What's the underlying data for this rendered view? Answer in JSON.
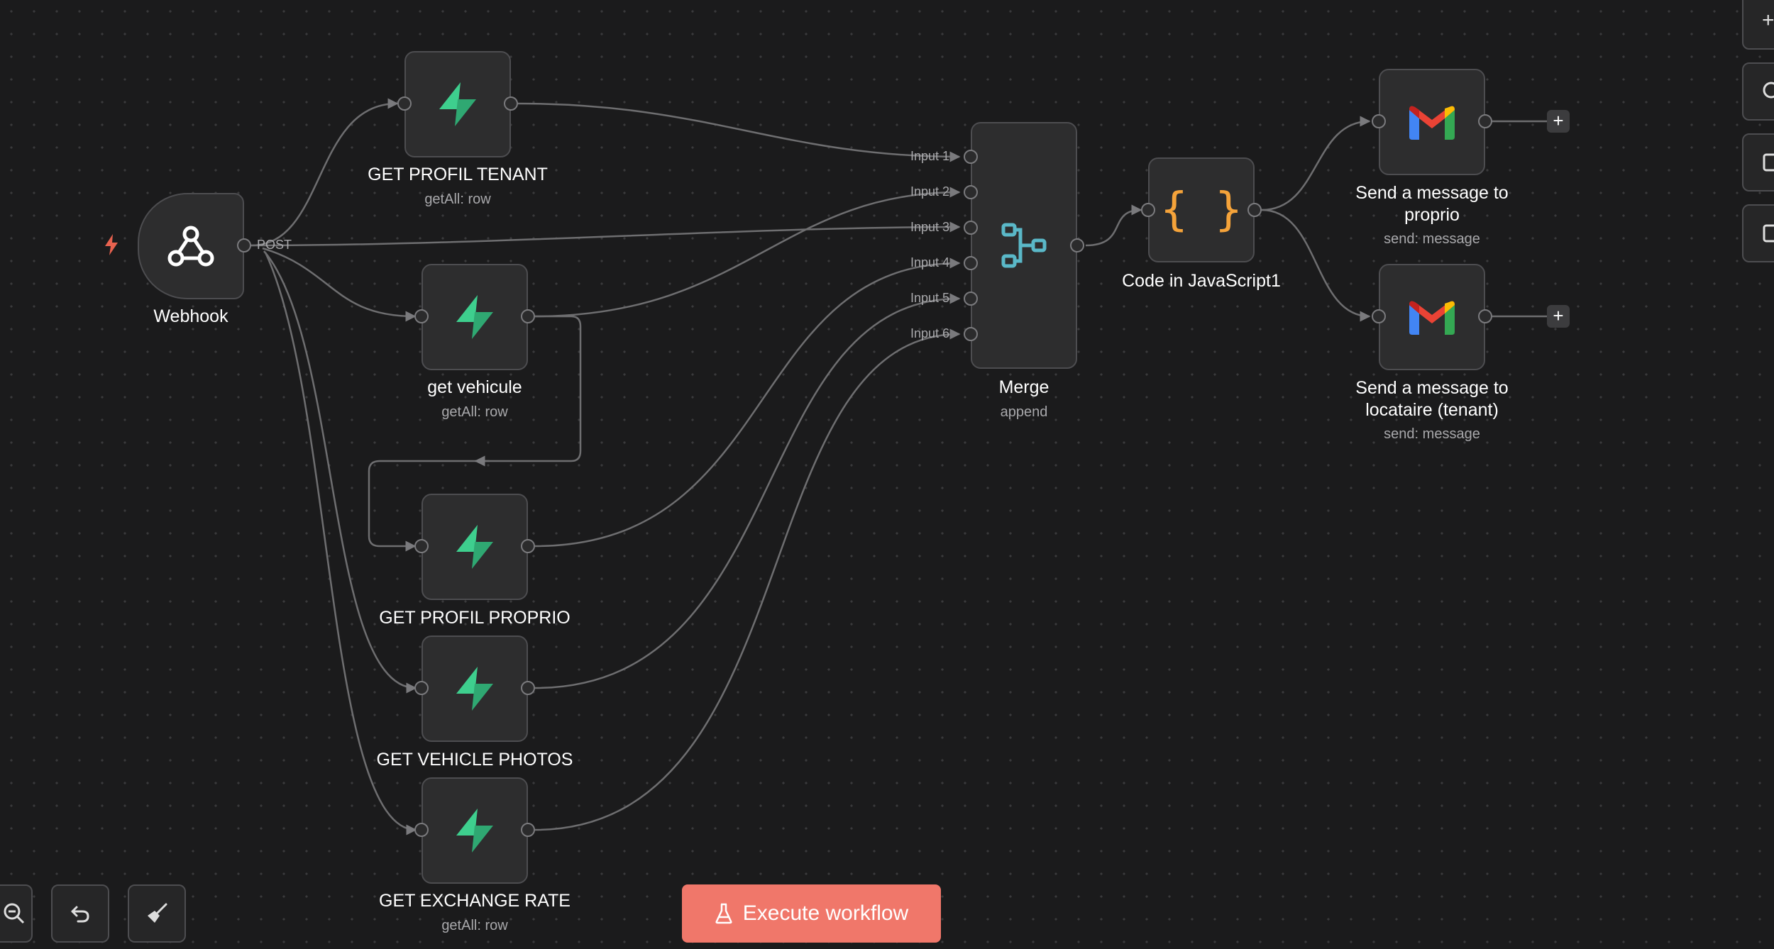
{
  "colors": {
    "canvas": "#1b1b1c",
    "node_bg": "#2d2d2e",
    "edge": "#6e6e70",
    "supabase_green": "#3ecf8e",
    "merge_blue": "#5ab8c8",
    "code_orange": "#f5a33a",
    "execute_button": "#f0776a",
    "trigger_bolt": "#e8624f"
  },
  "nodes": {
    "webhook": {
      "title": "Webhook",
      "output_label": "POST",
      "icon": "webhook-icon"
    },
    "get_profil_tenant": {
      "title": "GET PROFIL TENANT",
      "subtitle": "getAll: row",
      "icon": "supabase-icon"
    },
    "get_vehicule": {
      "title": "get vehicule",
      "subtitle": "getAll: row",
      "icon": "supabase-icon"
    },
    "get_profil_proprio": {
      "title": "GET PROFIL PROPRIO",
      "icon": "supabase-icon"
    },
    "get_vehicle_photos": {
      "title": "GET VEHICLE PHOTOS",
      "icon": "supabase-icon"
    },
    "get_exchange_rate": {
      "title": "GET EXCHANGE RATE",
      "subtitle": "getAll: row",
      "icon": "supabase-icon"
    },
    "merge": {
      "title": "Merge",
      "subtitle": "append",
      "icon": "merge-icon",
      "inputs": [
        "Input 1",
        "Input 2",
        "Input 3",
        "Input 4",
        "Input 5",
        "Input 6"
      ]
    },
    "code": {
      "title": "Code in JavaScript1",
      "icon": "code-braces-icon",
      "glyph": "{ }"
    },
    "send_proprio": {
      "title_line1": "Send a message to",
      "title_line2": "proprio",
      "subtitle": "send: message",
      "icon": "gmail-icon"
    },
    "send_tenant": {
      "title_line1": "Send a message to",
      "title_line2": "locataire (tenant)",
      "subtitle": "send: message",
      "icon": "gmail-icon"
    }
  },
  "toolbar": {
    "execute_label": "Execute workflow",
    "execute_icon": "flask-icon",
    "zoom_icon": "zoom-out-icon",
    "undo_icon": "undo-icon",
    "tidy_icon": "broom-icon"
  },
  "right_panel": {
    "buttons": [
      "plus-icon",
      "search-icon",
      "square-icon",
      "square-icon"
    ],
    "plus_glyph": "+"
  },
  "add_button_glyph": "+"
}
